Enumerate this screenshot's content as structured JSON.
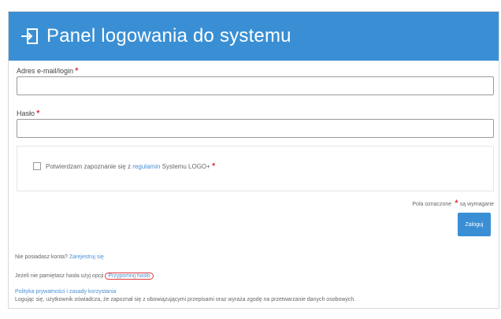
{
  "header": {
    "title": "Panel logowania do systemu"
  },
  "form": {
    "email_label": "Adres e-mail/login",
    "password_label": "Hasło",
    "required_star": "*",
    "consent_text_prefix": "Potwierdzam zapoznanie się z",
    "consent_link": "regulamin",
    "consent_text_suffix": "Systemu LOGO+",
    "required_note_prefix": "Pola oznaczone",
    "required_note_suffix": "są wymagane",
    "login_button": "Zaloguj"
  },
  "footer": {
    "register_prefix": "Nie posiadasz konta?",
    "register_link": "Zarejestruj się",
    "forgot_prefix": "Jeżeli nie pamiętasz hasła użyj opcji",
    "forgot_link": "Przypomnij hasło",
    "notice_title": "Polityka prywatności i zasady korzystania",
    "notice_text": "Logując się, użytkownik oświadcza, że zapoznał się z obowiązującymi przepisami oraz wyraża zgodę na przetwarzanie danych osobowych."
  },
  "colors": {
    "header_bg": "#3a8fd4",
    "link": "#4a8fd3",
    "required": "#d0021b",
    "highlight_outline": "#e0383d"
  }
}
